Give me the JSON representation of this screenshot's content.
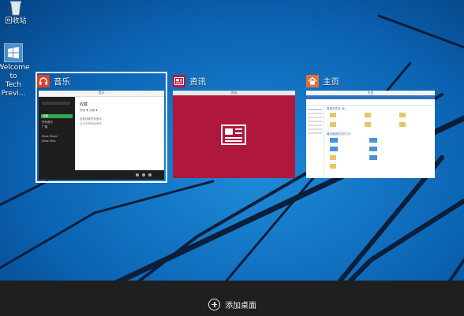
{
  "desktop": {
    "icons": [
      {
        "label": "回收站",
        "icon": "recycle-bin-icon"
      },
      {
        "label_line1": "Welcome to",
        "label_line2": "Tech Previ...",
        "icon": "windows-logo-icon"
      }
    ]
  },
  "task_view": {
    "windows": [
      {
        "title": "音乐",
        "icon": "headphones-icon",
        "icon_color": "#d4472c",
        "selected": true,
        "content": {
          "window_title": "音乐",
          "sidebar_items": [
            "收藏",
            "所有音乐",
            "广播",
            "Xbox Music",
            "Xbox Pass"
          ],
          "heading": "收藏",
          "lines": [
            "所有 ▼  日期 ▼",
            "没有找到任何音乐",
            "点击右侧添加音乐"
          ]
        }
      },
      {
        "title": "资讯",
        "icon": "newspaper-icon",
        "icon_color": "#b5193f",
        "selected": false,
        "content": {
          "window_title": "资讯",
          "background": "#b0173d"
        }
      },
      {
        "title": "主页",
        "icon": "home-icon",
        "icon_color": "#e0703a",
        "selected": false,
        "content": {
          "window_title": "主页",
          "group_frequent": "常用文件夹 (6)",
          "group_recent": "最近使用的文件 (5)",
          "folders": [
            "桌面",
            "下载",
            "文档",
            "图片",
            "视频",
            "音乐"
          ]
        }
      }
    ]
  },
  "taskbar": {
    "add_desktop_label": "添加桌面",
    "add_icon": "add-circle-icon"
  }
}
